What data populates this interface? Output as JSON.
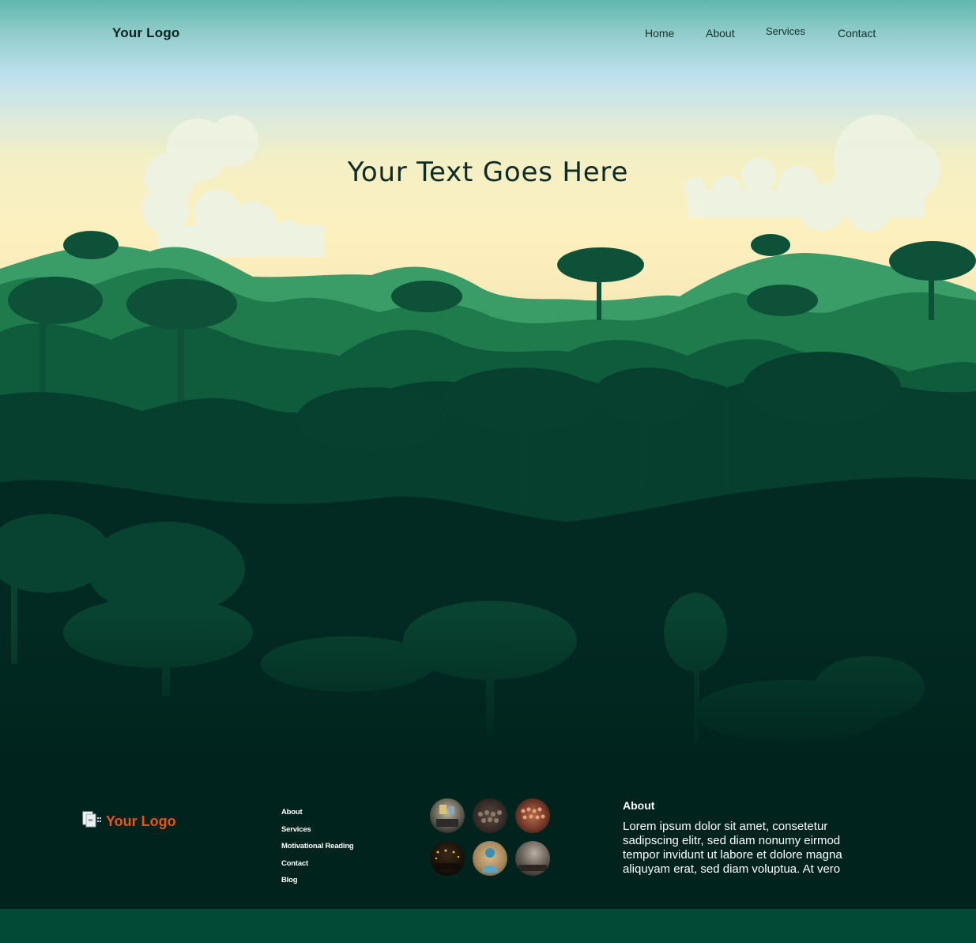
{
  "header": {
    "logo": "Your Logo",
    "nav": [
      {
        "label": "Home"
      },
      {
        "label": "About"
      },
      {
        "label": "Services"
      },
      {
        "label": "Contact"
      }
    ]
  },
  "hero": {
    "title": "Your Text Goes Here"
  },
  "footer": {
    "logo": "Your Logo",
    "logo_icon": "document-logo-icon",
    "links": [
      "About",
      "Services",
      "Motivational Reading",
      "Contact",
      "Blog"
    ],
    "gallery": [
      {
        "icon": "photo-room-icon"
      },
      {
        "icon": "photo-crowd-icon"
      },
      {
        "icon": "photo-crowd-icon"
      },
      {
        "icon": "photo-concert-icon"
      },
      {
        "icon": "photo-person-icon"
      },
      {
        "icon": "photo-hall-icon"
      }
    ],
    "about_heading": "About",
    "about_text": "Lorem ipsum dolor sit amet, consetetur sadipscing elitr, sed diam nonumy eirmod tempor invidunt ut labore et dolore magna aliquyam erat, sed diam voluptua. At vero"
  },
  "colors": {
    "footer_bg": "#00241d",
    "bottom_bar": "#034a36",
    "logo_accent": "#e2551c",
    "forest_dark": "#022a22",
    "forest_mid": "#0a5238",
    "forest_light": "#2e8e5c"
  }
}
